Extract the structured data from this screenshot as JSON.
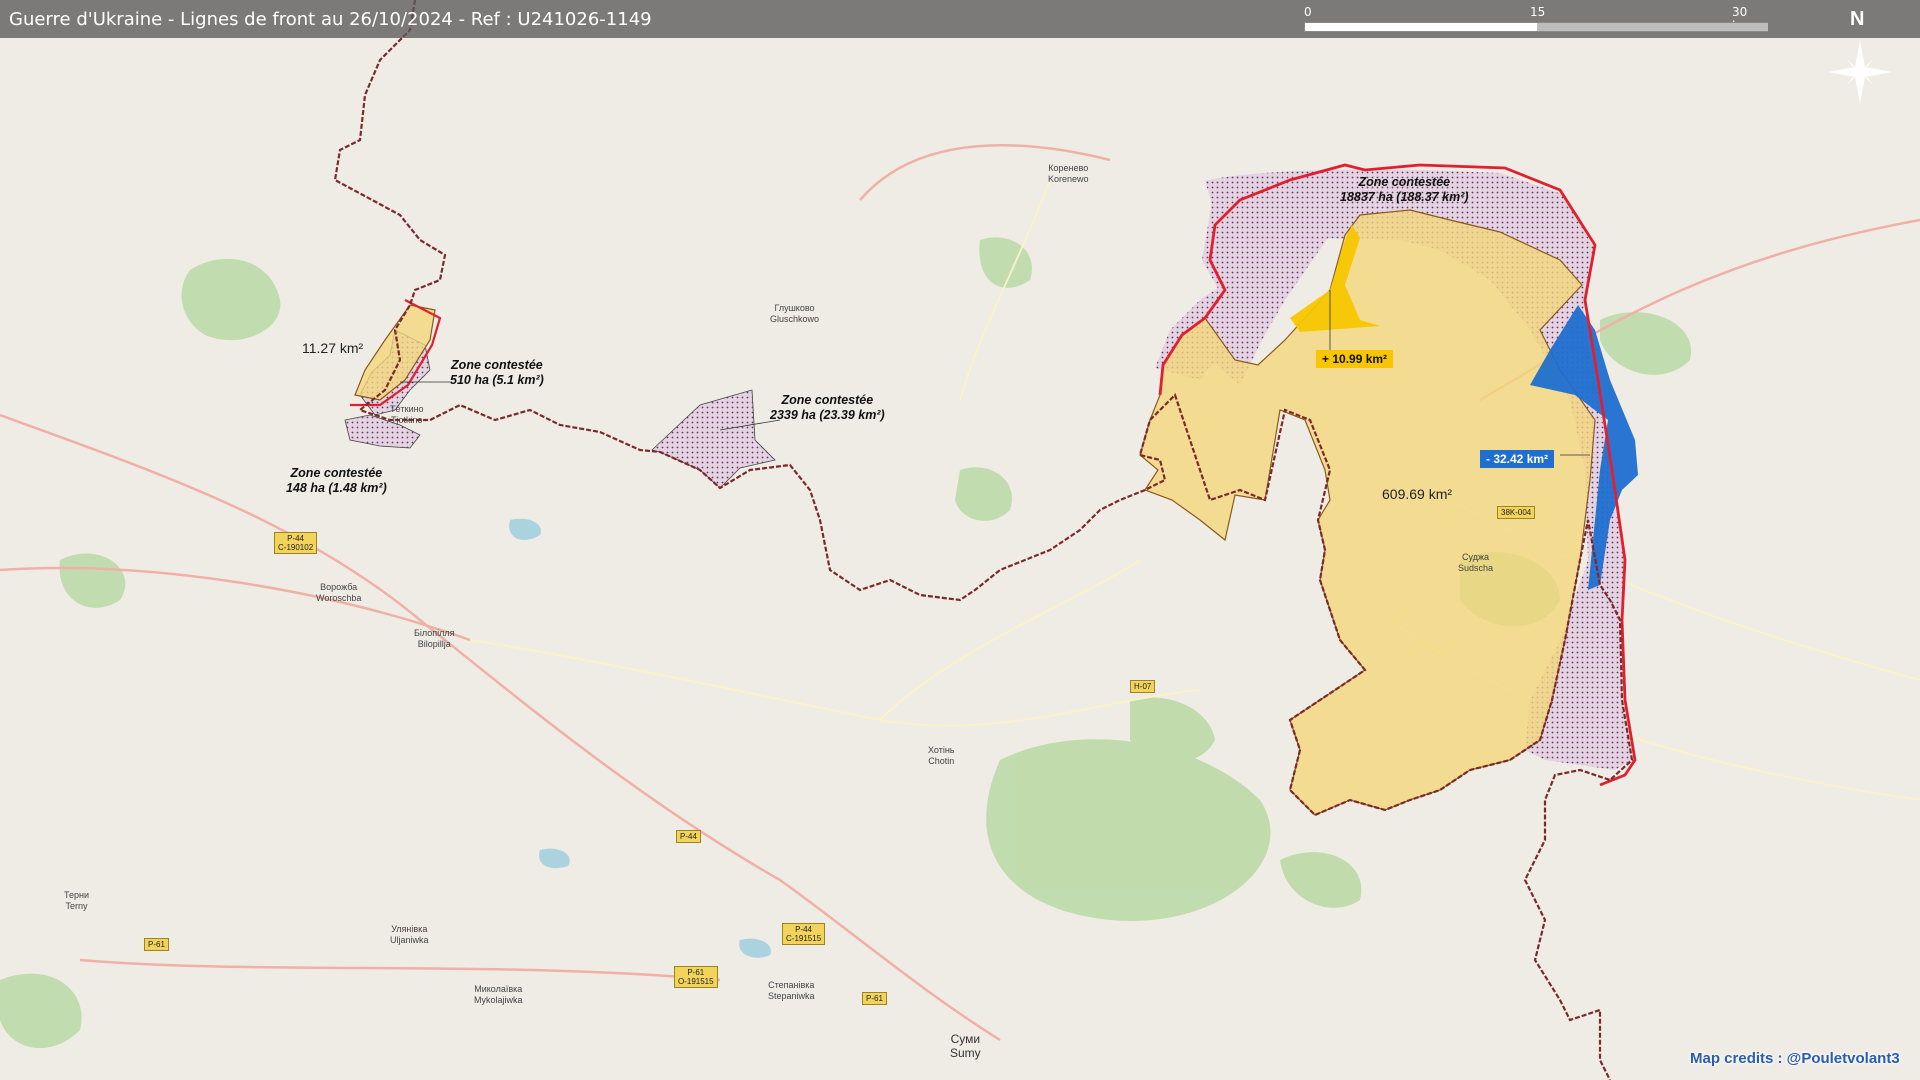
{
  "title": "Guerre d'Ukraine - Lignes de front au 26/10/2024 - Ref : U241026-1149",
  "scale": {
    "ticks": [
      "0",
      "15",
      "30 km"
    ]
  },
  "north_label": "N",
  "zones": {
    "contested_main": {
      "line1": "Zone contestée",
      "line2": "18837 ha (188.37 km²)"
    },
    "contested_west": {
      "line1": "Zone contestée",
      "line2": "510 ha (5.1 km²)"
    },
    "contested_center": {
      "line1": "Zone contestée",
      "line2": "2339 ha (23.39 km²)"
    },
    "contested_sw": {
      "line1": "Zone contestée",
      "line2": "148 ha (1.48 km²)"
    }
  },
  "areas": {
    "west_area": "11.27 km²",
    "main_area": "609.69 km²"
  },
  "changes": {
    "gain": "+ 10.99 km²",
    "loss": "- 32.42 km²"
  },
  "places": {
    "korenevo": {
      "line1": "Коренево",
      "line2": "Korenewo"
    },
    "glushkovo": {
      "line1": "Глушково",
      "line2": "Gluschkowo"
    },
    "tyotkino": {
      "line1": "Тёткино",
      "line2": "Tjotkino"
    },
    "vorozhba": {
      "line1": "Ворожба",
      "line2": "Woroschba"
    },
    "bilopillia": {
      "line1": "Білопілля",
      "line2": "Bilopillja"
    },
    "khotin": {
      "line1": "Хотінь",
      "line2": "Chotin"
    },
    "sudzha": {
      "line1": "Суджа",
      "line2": "Sudscha"
    },
    "terny": {
      "line1": "Терни",
      "line2": "Terny"
    },
    "ulianivka": {
      "line1": "Улянівка",
      "line2": "Uljaniwka"
    },
    "mykolaivka": {
      "line1": "Миколаївка",
      "line2": "Mykolajiwka"
    },
    "stepanivka": {
      "line1": "Степанівка",
      "line2": "Stepaniwka"
    },
    "sumy": {
      "line1": "Суми",
      "line2": "Sumy"
    }
  },
  "roads": {
    "r1": {
      "line1": "P-44",
      "line2": "C-190102"
    },
    "r2": {
      "line1": "H-07",
      "line2": ""
    },
    "r3": {
      "line1": "P-44",
      "line2": ""
    },
    "r4": {
      "line1": "P-44",
      "line2": "C-191515"
    },
    "r5": {
      "line1": "P-61",
      "line2": ""
    },
    "r6": {
      "line1": "P-61",
      "line2": "O-191515"
    },
    "r7": {
      "line1": "P-61",
      "line2": ""
    },
    "r8": {
      "line1": "38K-004",
      "line2": ""
    }
  },
  "credits": "Map credits : @Pouletvolant3",
  "colors": {
    "controlled": "#f4d77a",
    "gain": "#f7c600",
    "loss": "#1f6fd0",
    "contested": "#e7d3e5",
    "front_line": "#e0202e",
    "border": "#7a2a2a"
  }
}
